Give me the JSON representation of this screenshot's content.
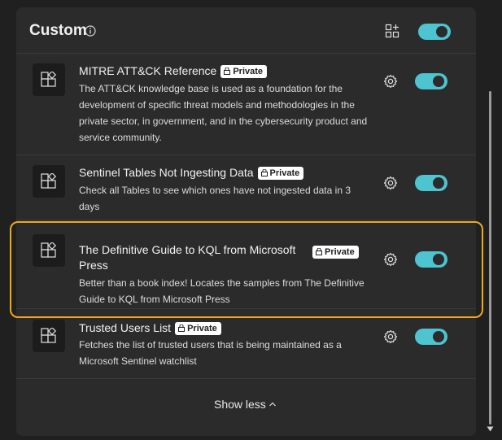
{
  "section": {
    "title": "Custom",
    "enabled": true
  },
  "badge_label": "Private",
  "items": [
    {
      "title": "MITRE ATT&CK Reference",
      "description": "The ATT&CK knowledge base is used as a foundation for the development of specific threat models and methodologies in the private sector, in government, and in the cybersecurity product and service community.",
      "enabled": true
    },
    {
      "title": "Sentinel Tables Not Ingesting Data",
      "description": "Check all Tables to see which ones have not ingested data in 3 days",
      "enabled": true
    },
    {
      "title": "The Definitive Guide to KQL from Microsoft Press",
      "description": "Better than a book index! Locates the samples from The Definitive Guide to KQL from Microsoft Press",
      "enabled": true
    },
    {
      "title": "Trusted Users List",
      "description": "Fetches the list of trusted users that is being maintained as a Microsoft Sentinel watchlist",
      "enabled": true
    }
  ],
  "footer": {
    "show_less_label": "Show less"
  },
  "colors": {
    "accent": "#4dc4cf",
    "highlight": "#f0a81c",
    "panel": "#2b2b2b",
    "background": "#202020"
  }
}
